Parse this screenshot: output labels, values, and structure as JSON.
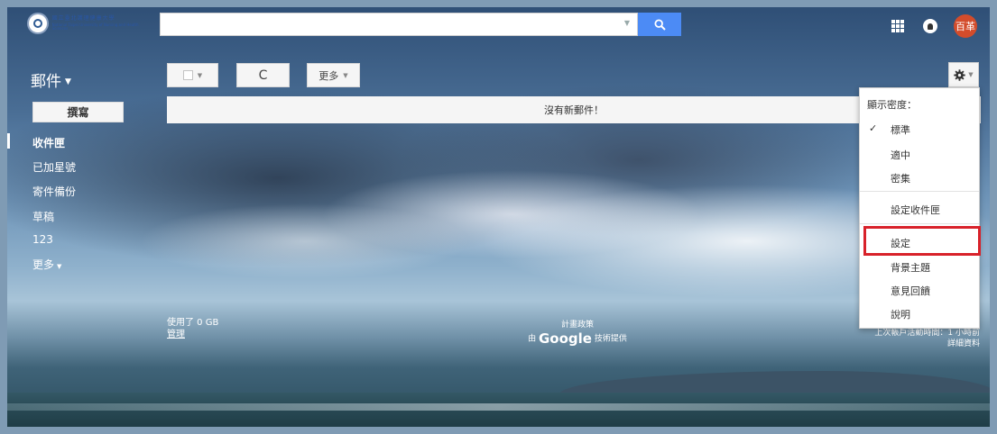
{
  "header": {
    "logo": {
      "name_zh": "國立臺北護理健康大學",
      "name_en": "National Taipei University of Nursing and Health Sciences"
    },
    "search": {
      "value": "",
      "placeholder": ""
    },
    "avatar_text": "百革"
  },
  "toolbar": {
    "mail_label": "郵件",
    "refresh_glyph": "C",
    "more_label": "更多"
  },
  "sidebar": {
    "compose_label": "撰寫",
    "items": [
      {
        "label": "收件匣",
        "active": true
      },
      {
        "label": "已加星號",
        "active": false
      },
      {
        "label": "寄件備份",
        "active": false
      },
      {
        "label": "草稿",
        "active": false
      },
      {
        "label": "123",
        "active": false
      },
      {
        "label": "更多",
        "active": false
      }
    ]
  },
  "main": {
    "empty_message": "沒有新郵件！"
  },
  "footer": {
    "storage_used": "使用了 0 GB",
    "manage_label": "管理",
    "terms_label": "計畫政策",
    "powered_prefix": "由",
    "powered_brand": "Google",
    "powered_suffix": "技術提供",
    "activity_line1": "上次帳戶活動時間：1 小時前",
    "activity_line2": "詳細資料"
  },
  "settings_menu": {
    "density_heading": "顯示密度：",
    "density_options": [
      "標準",
      "適中",
      "密集"
    ],
    "selected_density": "標準",
    "configure_inbox": "設定收件匣",
    "settings": "設定",
    "themes": "背景主題",
    "feedback": "意見回饋",
    "help": "說明"
  },
  "colors": {
    "search_button": "#4c8bf5",
    "avatar_bg": "#d34c2b",
    "highlight_border": "#d8212a"
  }
}
